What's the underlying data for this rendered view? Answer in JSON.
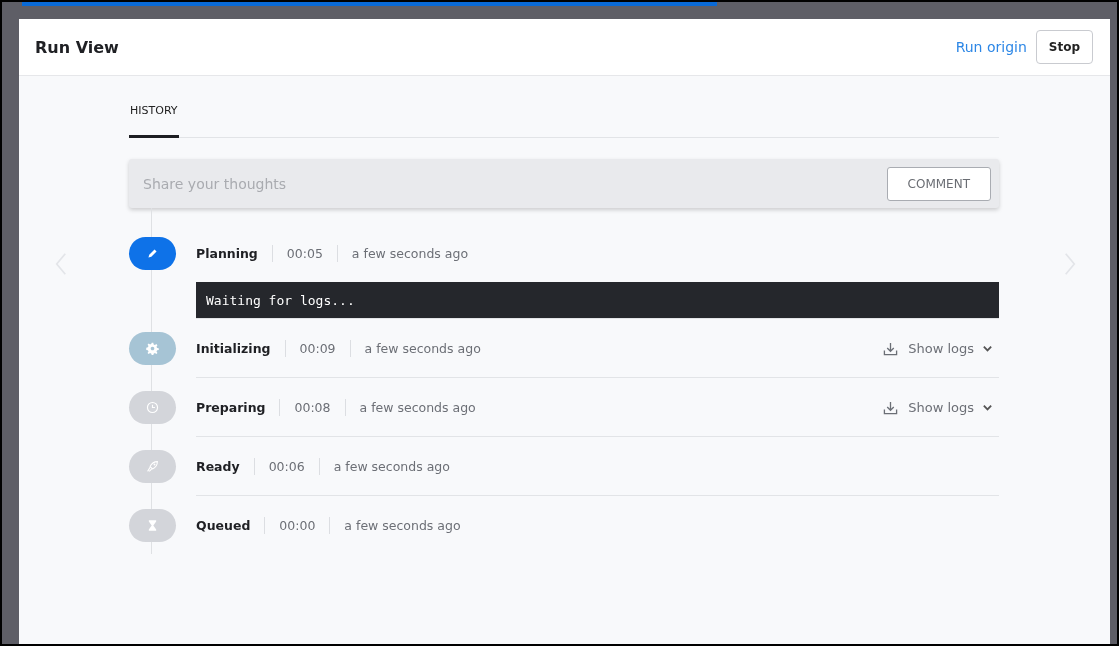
{
  "header": {
    "title": "Run View",
    "link": "Run origin",
    "button": "Stop"
  },
  "tabs": [
    {
      "label": "HISTORY",
      "selected": true
    }
  ],
  "comment": {
    "placeholder": "Share your thoughts",
    "button": "COMMENT"
  },
  "steps": [
    {
      "name": "Planning",
      "duration": "00:05",
      "time": "a few seconds ago",
      "kind": "pencil",
      "color": "#0e72e8",
      "log": "Waiting for logs..."
    },
    {
      "name": "Initializing",
      "duration": "00:09",
      "time": "a few seconds ago",
      "kind": "gear",
      "color": "#a6c4d5",
      "logs_button": "Show logs"
    },
    {
      "name": "Preparing",
      "duration": "00:08",
      "time": "a few seconds ago",
      "kind": "clock",
      "color": "#d3d5da",
      "logs_button": "Show logs"
    },
    {
      "name": "Ready",
      "duration": "00:06",
      "time": "a few seconds ago",
      "kind": "rocket",
      "color": "#d3d5da"
    },
    {
      "name": "Queued",
      "duration": "00:00",
      "time": "a few seconds ago",
      "kind": "hourglass",
      "color": "#d3d5da"
    }
  ]
}
